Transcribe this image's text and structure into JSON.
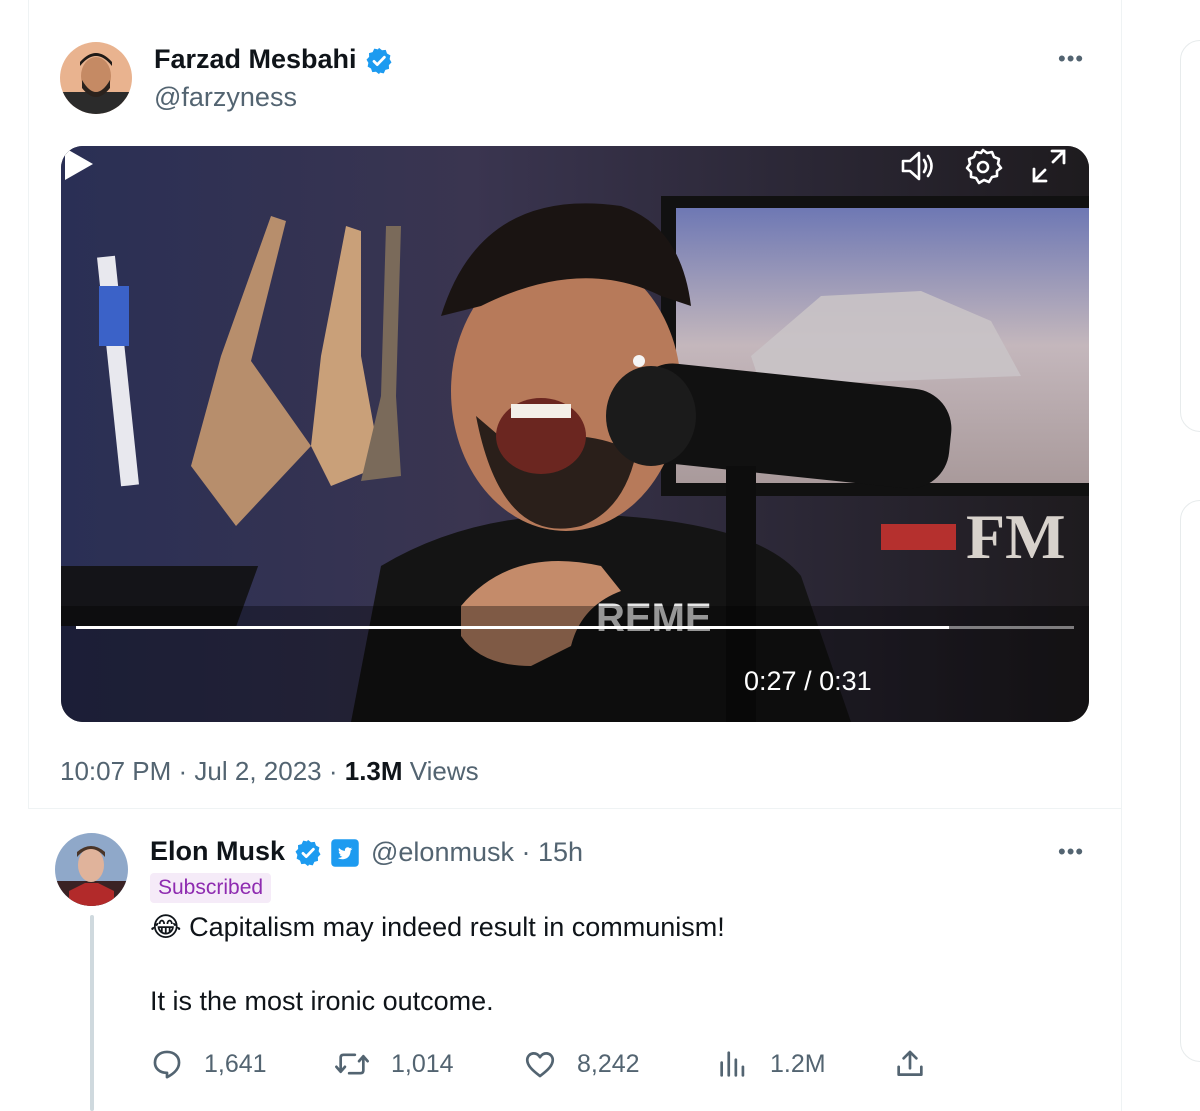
{
  "quoted_tweet": {
    "author_name": "Farzad Mesbahi",
    "author_handle": "@farzyness",
    "verified_icon": "verified-badge-icon",
    "more_icon": "more-options-icon",
    "video": {
      "current_time": "0:27",
      "duration_separator": "/",
      "duration": "0:31",
      "progress_fraction": 0.875,
      "poster_texts": {
        "shirt": "REME",
        "sign": "FM"
      }
    },
    "timestamp": "10:07 PM",
    "date": "Jul 2, 2023",
    "views_count": "1.3M",
    "views_label": "Views"
  },
  "reply_tweet": {
    "author_name": "Elon Musk",
    "author_handle": "@elonmusk",
    "age": "15h",
    "subscribed_label": "Subscribed",
    "line1_emoji": "😂",
    "line1": "Capitalism may indeed result in communism!",
    "line2": "It is the most ironic outcome.",
    "actions": {
      "replies": "1,641",
      "retweets": "1,014",
      "likes": "8,242",
      "views": "1.2M"
    }
  },
  "colors": {
    "verified_blue": "#1d9bf0",
    "text_secondary": "#536471",
    "subscribed_purple": "#8e2bb0"
  }
}
